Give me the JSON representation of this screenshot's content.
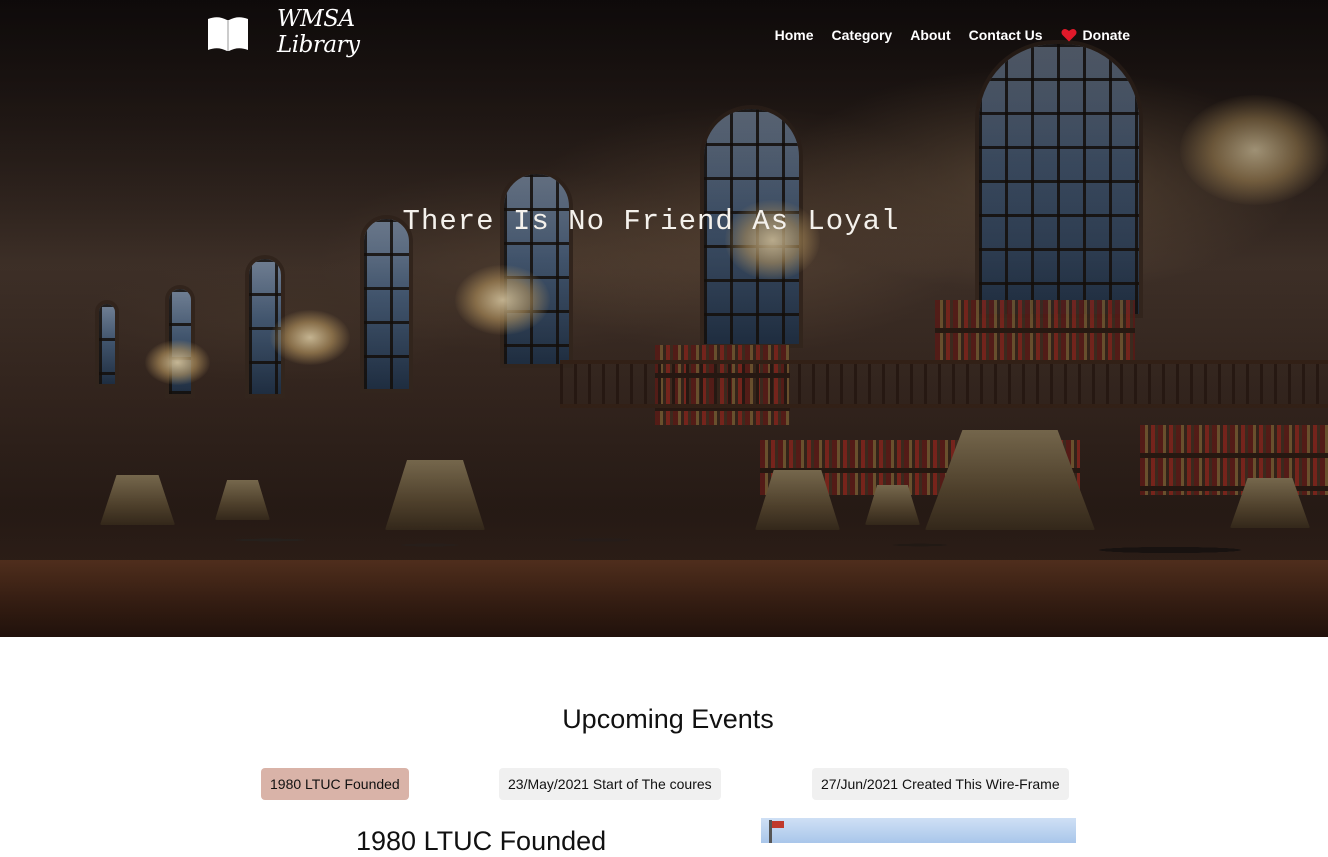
{
  "brand": {
    "line1": "WMSA",
    "line2": "Library"
  },
  "nav": {
    "items": [
      "Home",
      "Category",
      "About",
      "Contact Us"
    ],
    "donate": "Donate"
  },
  "hero": {
    "title": "There Is No Friend As Loyal"
  },
  "events": {
    "heading": "Upcoming Events",
    "tabs": [
      {
        "label": "1980 LTUC Founded",
        "active": true
      },
      {
        "label": "23/May/2021 Start of The coures",
        "active": false
      },
      {
        "label": "27/Jun/2021 Created This Wire-Frame",
        "active": false
      }
    ],
    "selected_title": "1980 LTUC Founded"
  },
  "colors": {
    "active_tab": "#d9b3a8",
    "tab": "#f0f0f0",
    "heart": "#e0192a"
  }
}
